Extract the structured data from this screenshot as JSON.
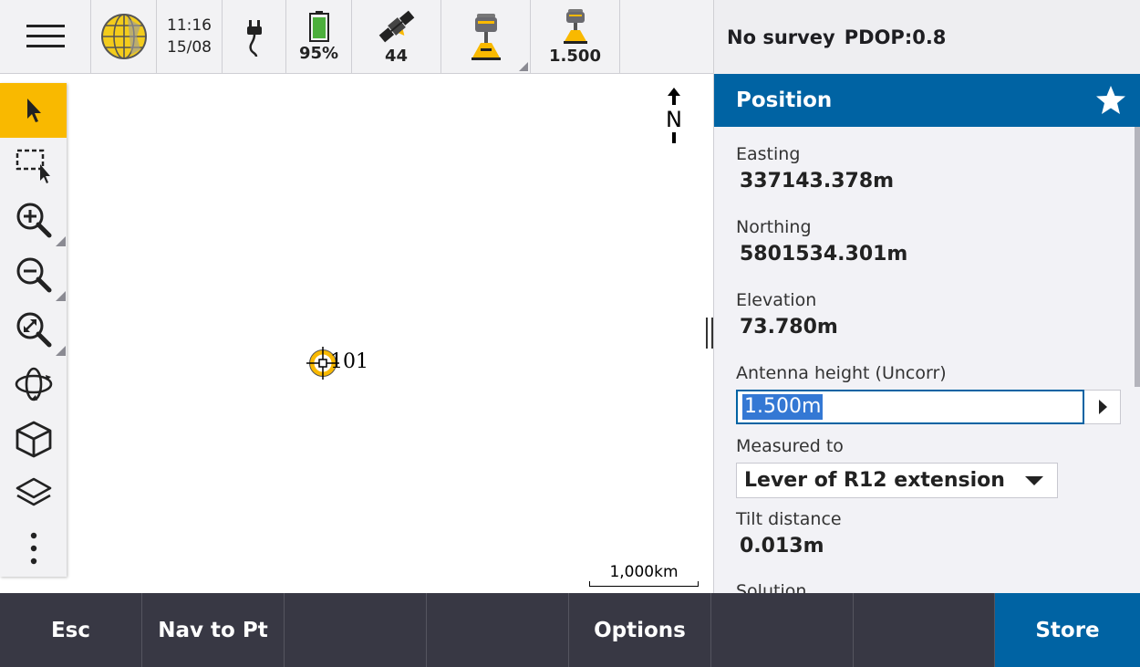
{
  "status": {
    "time": "11:16",
    "date": "15/08",
    "battery": "95%",
    "satellites": "44",
    "antenna_height": "1.500",
    "survey_state": "No survey",
    "pdop": "PDOP:0.8"
  },
  "map": {
    "north_label": "N",
    "point_label": "101",
    "scale_label": "1,000km"
  },
  "panel": {
    "title": "Position",
    "easting_label": "Easting",
    "easting_value": "337143.378m",
    "northing_label": "Northing",
    "northing_value": "5801534.301m",
    "elevation_label": "Elevation",
    "elevation_value": "73.780m",
    "antenna_label": "Antenna height (Uncorr)",
    "antenna_value": "1.500m",
    "measured_label": "Measured to",
    "measured_value": "Lever of R12 extension",
    "tilt_label": "Tilt distance",
    "tilt_value": "0.013m",
    "solution_label": "Solution"
  },
  "softkeys": {
    "esc": "Esc",
    "nav": "Nav to Pt",
    "options": "Options",
    "store": "Store"
  },
  "colors": {
    "accent_blue": "#0063a3",
    "tool_active": "#f9b900",
    "softkey_bg": "#383844"
  },
  "icons": [
    "menu-icon",
    "globe-icon",
    "power-plug-icon",
    "battery-icon",
    "satellite-icon",
    "receiver-icon",
    "antenna-icon",
    "select-arrow-icon",
    "box-select-icon",
    "zoom-in-icon",
    "zoom-out-icon",
    "zoom-extents-icon",
    "orbit-icon",
    "cube-icon",
    "layers-icon",
    "more-icon",
    "star-icon",
    "north-arrow-icon"
  ]
}
